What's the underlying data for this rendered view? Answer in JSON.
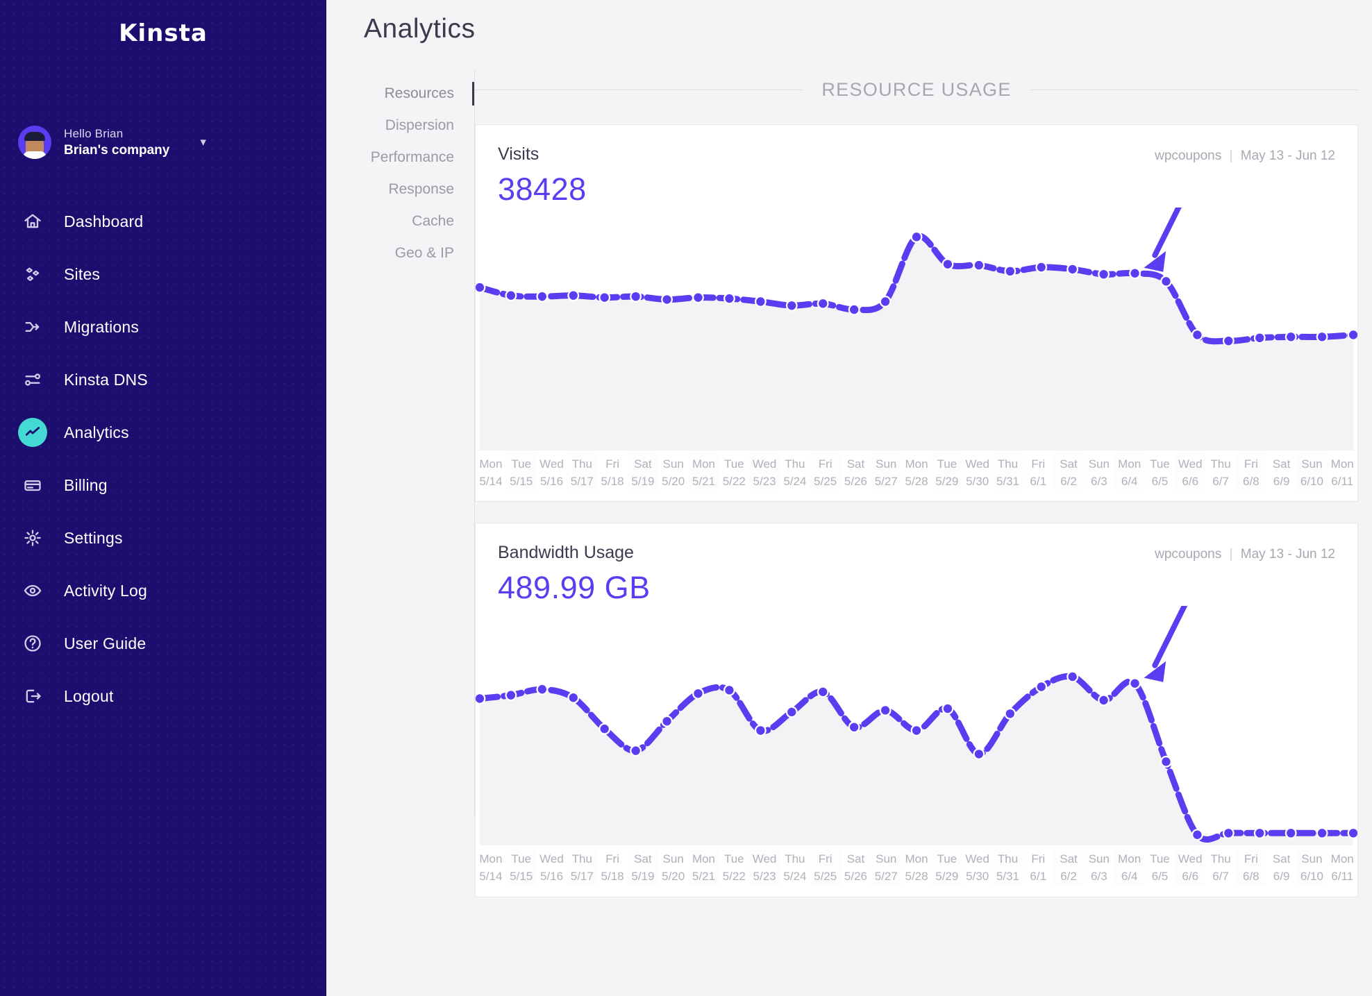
{
  "sidebar": {
    "brand": "Kinsta",
    "profile": {
      "greeting": "Hello Brian",
      "company": "Brian's company",
      "chevron": "chevron-down-icon"
    },
    "items": [
      {
        "label": "Dashboard",
        "icon": "home-icon",
        "active": false
      },
      {
        "label": "Sites",
        "icon": "sites-icon",
        "active": false
      },
      {
        "label": "Migrations",
        "icon": "migrations-icon",
        "active": false
      },
      {
        "label": "Kinsta DNS",
        "icon": "dns-icon",
        "active": false
      },
      {
        "label": "Analytics",
        "icon": "analytics-icon",
        "active": true
      },
      {
        "label": "Billing",
        "icon": "card-icon",
        "active": false
      },
      {
        "label": "Settings",
        "icon": "gear-icon",
        "active": false
      },
      {
        "label": "Activity Log",
        "icon": "eye-icon",
        "active": false
      },
      {
        "label": "User Guide",
        "icon": "question-icon",
        "active": false
      },
      {
        "label": "Logout",
        "icon": "logout-icon",
        "active": false
      }
    ]
  },
  "header": {
    "title": "Analytics"
  },
  "subnav": {
    "items": [
      {
        "label": "Resources",
        "active": true
      },
      {
        "label": "Dispersion",
        "active": false
      },
      {
        "label": "Performance",
        "active": false
      },
      {
        "label": "Response",
        "active": false
      },
      {
        "label": "Cache",
        "active": false
      },
      {
        "label": "Geo & IP",
        "active": false
      }
    ]
  },
  "section": {
    "title": "RESOURCE USAGE"
  },
  "colors": {
    "accent": "#5b3cf0",
    "sidebar": "#1b0e6e",
    "active_pill": "#45d9d4",
    "area_fill": "#f3f3f5",
    "axis_text": "#b0b0ba"
  },
  "cards": [
    {
      "title": "Visits",
      "value": "38428",
      "site": "wpcoupons",
      "separator": "|",
      "range": "May 13 - Jun 12"
    },
    {
      "title": "Bandwidth Usage",
      "value": "489.99 GB",
      "site": "wpcoupons",
      "separator": "|",
      "range": "May 13 - Jun 12"
    }
  ],
  "chart_data": [
    {
      "type": "line",
      "title": "Visits",
      "total": 38428,
      "xlabel": "",
      "ylabel": "Visits",
      "grid": false,
      "legend": null,
      "ylim": [
        0,
        2200
      ],
      "annotation": {
        "type": "arrow",
        "direction": "down-left",
        "points_to": "6/4"
      },
      "categories": [
        "Mon 5/14",
        "Tue 5/15",
        "Wed 5/16",
        "Thu 5/17",
        "Fri 5/18",
        "Sat 5/19",
        "Sun 5/20",
        "Mon 5/21",
        "Tue 5/22",
        "Wed 5/23",
        "Thu 5/24",
        "Fri 5/25",
        "Sat 5/26",
        "Sun 5/27",
        "Mon 5/28",
        "Tue 5/29",
        "Wed 5/30",
        "Thu 5/31",
        "Fri 6/1",
        "Sat 6/2",
        "Sun 6/3",
        "Mon 6/4",
        "Tue 6/5",
        "Wed 6/6",
        "Thu 6/7",
        "Fri 6/8",
        "Sat 6/9",
        "Sun 6/10",
        "Mon 6/11"
      ],
      "weekday": [
        "Mon",
        "Tue",
        "Wed",
        "Thu",
        "Fri",
        "Sat",
        "Sun",
        "Mon",
        "Tue",
        "Wed",
        "Thu",
        "Fri",
        "Sat",
        "Sun",
        "Mon",
        "Tue",
        "Wed",
        "Thu",
        "Fri",
        "Sat",
        "Sun",
        "Mon",
        "Tue",
        "Wed",
        "Thu",
        "Fri",
        "Sat",
        "Sun",
        "Mon"
      ],
      "dates": [
        "5/14",
        "5/15",
        "5/16",
        "5/17",
        "5/18",
        "5/19",
        "5/20",
        "5/21",
        "5/22",
        "5/23",
        "5/24",
        "5/25",
        "5/26",
        "5/27",
        "5/28",
        "5/29",
        "5/30",
        "5/31",
        "6/1",
        "6/2",
        "6/3",
        "6/4",
        "6/5",
        "6/6",
        "6/7",
        "6/8",
        "6/9",
        "6/10",
        "6/11"
      ],
      "values": [
        1560,
        1480,
        1470,
        1480,
        1460,
        1470,
        1440,
        1460,
        1450,
        1420,
        1380,
        1400,
        1340,
        1420,
        2060,
        1790,
        1780,
        1720,
        1760,
        1740,
        1690,
        1700,
        1620,
        1090,
        1030,
        1060,
        1070,
        1070,
        1090
      ]
    },
    {
      "type": "line",
      "title": "Bandwidth Usage",
      "total": "489.99 GB",
      "xlabel": "",
      "ylabel": "GB",
      "grid": false,
      "legend": null,
      "ylim": [
        0,
        26
      ],
      "annotation": {
        "type": "arrow",
        "direction": "down-left",
        "points_to": "6/4"
      },
      "categories": [
        "Mon 5/14",
        "Tue 5/15",
        "Wed 5/16",
        "Thu 5/17",
        "Fri 5/18",
        "Sat 5/19",
        "Sun 5/20",
        "Mon 5/21",
        "Tue 5/22",
        "Wed 5/23",
        "Thu 5/24",
        "Fri 5/25",
        "Sat 5/26",
        "Sun 5/27",
        "Mon 5/28",
        "Tue 5/29",
        "Wed 5/30",
        "Thu 5/31",
        "Fri 6/1",
        "Sat 6/2",
        "Sun 6/3",
        "Mon 6/4",
        "Tue 6/5",
        "Wed 6/6",
        "Thu 6/7",
        "Fri 6/8",
        "Sat 6/9",
        "Sun 6/10",
        "Mon 6/11"
      ],
      "weekday": [
        "Mon",
        "Tue",
        "Wed",
        "Thu",
        "Fri",
        "Sat",
        "Sun",
        "Mon",
        "Tue",
        "Wed",
        "Thu",
        "Fri",
        "Sat",
        "Sun",
        "Mon",
        "Tue",
        "Wed",
        "Thu",
        "Fri",
        "Sat",
        "Sun",
        "Mon",
        "Tue",
        "Wed",
        "Thu",
        "Fri",
        "Sat",
        "Sun",
        "Mon"
      ],
      "dates": [
        "5/14",
        "5/15",
        "5/16",
        "5/17",
        "5/18",
        "5/19",
        "5/20",
        "5/21",
        "5/22",
        "5/23",
        "5/24",
        "5/25",
        "5/26",
        "5/27",
        "5/28",
        "5/29",
        "5/30",
        "5/31",
        "6/1",
        "6/2",
        "6/3",
        "6/4",
        "6/5",
        "6/6",
        "6/7",
        "6/8",
        "6/9",
        "6/10",
        "6/11"
      ],
      "values": [
        16.8,
        17.2,
        17.9,
        16.9,
        13.2,
        10.6,
        14.1,
        17.4,
        17.8,
        13.0,
        15.2,
        17.6,
        13.4,
        15.4,
        13.0,
        15.6,
        10.2,
        15.0,
        18.2,
        19.4,
        16.6,
        18.6,
        9.3,
        0.6,
        0.8,
        0.8,
        0.8,
        0.8,
        0.8
      ]
    }
  ]
}
